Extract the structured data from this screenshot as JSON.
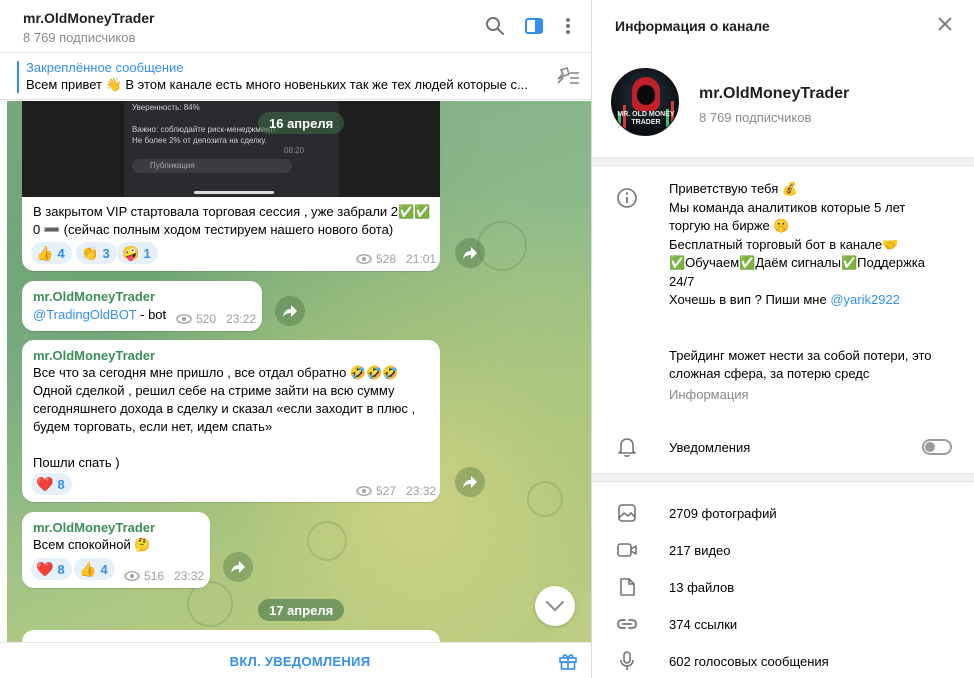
{
  "chat": {
    "title": "mr.OldMoneyTrader",
    "subscribers": "8 769 подписчиков",
    "pinned_title": "Закреплённое сообщение",
    "pinned_text": "Всем привет 👋 В этом канале есть много новеньких так же тех людей которые с..."
  },
  "media_preview": {
    "confidence": "Уверенность: 84%",
    "warning": "Важно: соблюдайте риск-менеджмент!",
    "warning2": "Не более 2% от депозита на сделку.",
    "time": "08:20",
    "input_placeholder": "Публикация"
  },
  "dates": {
    "d1": "16 апреля",
    "d2": "17 апреля"
  },
  "messages": [
    {
      "text": "В закрытом VIP стартовала торговая сессия , уже забрали 2✅✅\n0 ➖ (сейчас полным ходом тестируем нашего нового бота)",
      "reactions": [
        {
          "emoji": "👍",
          "count": "4"
        },
        {
          "emoji": "👏",
          "count": "3"
        },
        {
          "emoji": "🤪",
          "count": "1"
        }
      ],
      "views": "528",
      "time": "21:01"
    },
    {
      "author": "mr.OldMoneyTrader",
      "link": "@TradingOldBOT",
      "text": " - bot",
      "views": "520",
      "time": "23:22"
    },
    {
      "author": "mr.OldMoneyTrader",
      "text": "Все что за сегодня мне пришло , все отдал обратно 🤣🤣🤣\nОдной сделкой , решил себе на стриме зайти на всю сумму\nсегодняшнего дохода в сделку и сказал «если заходит в плюс ,\nбудем торговать, если нет, идем спать»\n\nПошли спать )",
      "reactions": [
        {
          "emoji": "❤️",
          "count": "8"
        }
      ],
      "views": "527",
      "time": "23:32"
    },
    {
      "author": "mr.OldMoneyTrader",
      "text": "Всем спокойной 🤔",
      "reactions": [
        {
          "emoji": "❤️",
          "count": "8"
        },
        {
          "emoji": "👍",
          "count": "4"
        }
      ],
      "views": "516",
      "time": "23:32"
    }
  ],
  "bottom": {
    "unmute_label": "ВКЛ. УВЕДОМЛЕНИЯ"
  },
  "info": {
    "panel_title": "Информация о канале",
    "name": "mr.OldMoneyTrader",
    "subscribers": "8 769 подписчиков",
    "avatar_text": "MR. OLD MONEY TRADER",
    "about_text": "Приветствую тебя 💰\nМы команда аналитиков которые 5 лет\nторгую на бирже 🤫\nБесплатный торговый бот в канале🤝\n✅Обучаем✅Даём сигналы✅Поддержка\n24/7\nХочешь в вип ? Пиши мне ",
    "about_link": "@yarik2922",
    "about_text2": "Трейдинг может нести за собой потери, это\nсложная сфера, за потерю средс",
    "about_label": "Информация",
    "notifications_label": "Уведомления",
    "notifications_on": false,
    "media": {
      "photos": "2709 фотографий",
      "videos": "217 видео",
      "files": "13 файлов",
      "links": "374 ссылки",
      "voice": "602 голосовых сообщения"
    }
  },
  "colors": {
    "accent": "#3390ec",
    "author": "#3d8f5a",
    "reaction_bg": "#e6f0fb"
  }
}
